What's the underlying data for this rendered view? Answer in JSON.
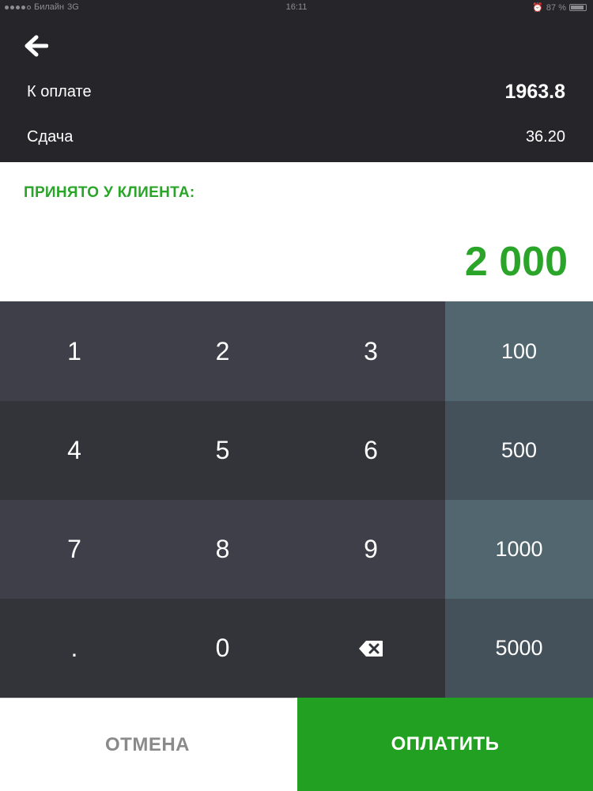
{
  "status_bar": {
    "carrier": "Билайн",
    "network": "3G",
    "time": "16:11",
    "battery": "87 %"
  },
  "header": {
    "back_icon": "arrow-left-icon",
    "to_pay_label": "К оплате",
    "to_pay_value": "1963.8",
    "change_label": "Сдача",
    "change_value": "36.20"
  },
  "received": {
    "title": "ПРИНЯТО У КЛИЕНТА:",
    "amount": "2 000",
    "color": "#2aa52a"
  },
  "keypad": {
    "keys": [
      "1",
      "2",
      "3",
      "4",
      "5",
      "6",
      "7",
      "8",
      "9",
      ".",
      "0"
    ],
    "backspace_icon": "backspace-icon",
    "quick_amounts": [
      "100",
      "500",
      "1000",
      "5000"
    ]
  },
  "actions": {
    "cancel_label": "ОТМЕНА",
    "pay_label": "ОПЛАТИТЬ",
    "pay_color": "#22a021"
  }
}
